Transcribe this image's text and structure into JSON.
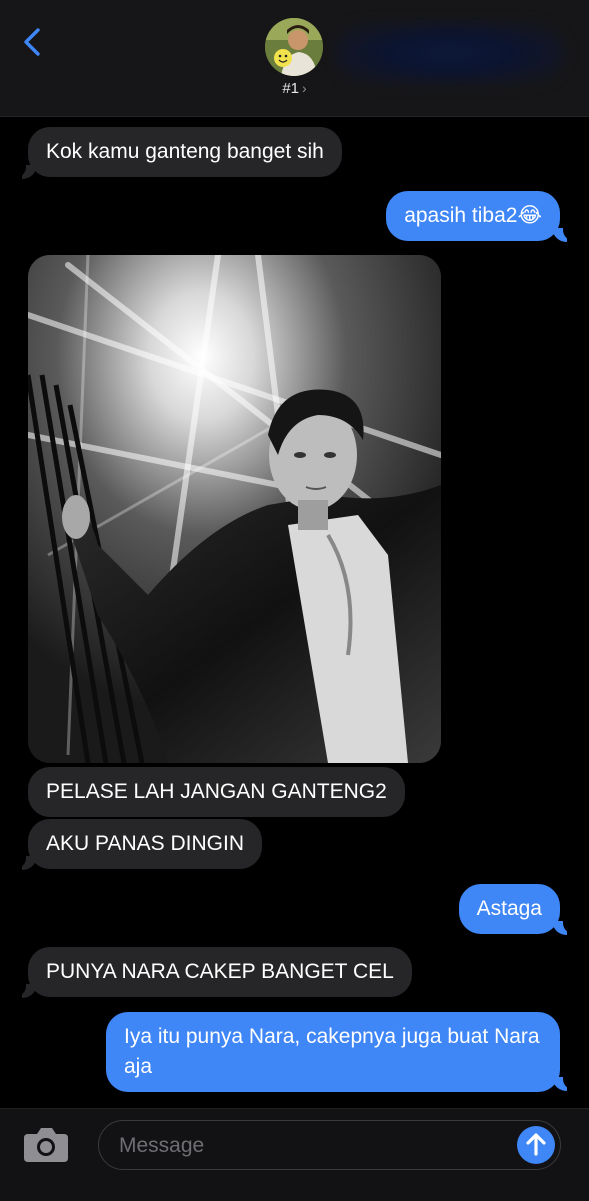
{
  "header": {
    "contact_name": "#1",
    "chevron": "›",
    "back_icon": "chevron-left-icon",
    "avatar_icon": "contact-avatar"
  },
  "messages": [
    {
      "direction": "incoming",
      "text": "Kok kamu ganteng banget sih"
    },
    {
      "direction": "outgoing",
      "text": "apasih tiba2😂"
    },
    {
      "direction": "incoming",
      "type": "image"
    },
    {
      "direction": "incoming",
      "text": "PELASE LAH JANGAN GANTENG2"
    },
    {
      "direction": "incoming",
      "text": "AKU PANAS DINGIN"
    },
    {
      "direction": "outgoing",
      "text": "Astaga"
    },
    {
      "direction": "incoming",
      "text": "PUNYA NARA CAKEP BANGET CEL"
    },
    {
      "direction": "outgoing",
      "text": "Iya itu punya Nara, cakepnya juga buat Nara aja"
    }
  ],
  "composer": {
    "placeholder": "Message",
    "camera_icon": "camera-icon",
    "send_icon": "arrow-up-icon"
  },
  "colors": {
    "background": "#000000",
    "incoming_bubble": "#262628",
    "outgoing_bubble": "#3f86f6",
    "accent": "#3f86f6"
  }
}
